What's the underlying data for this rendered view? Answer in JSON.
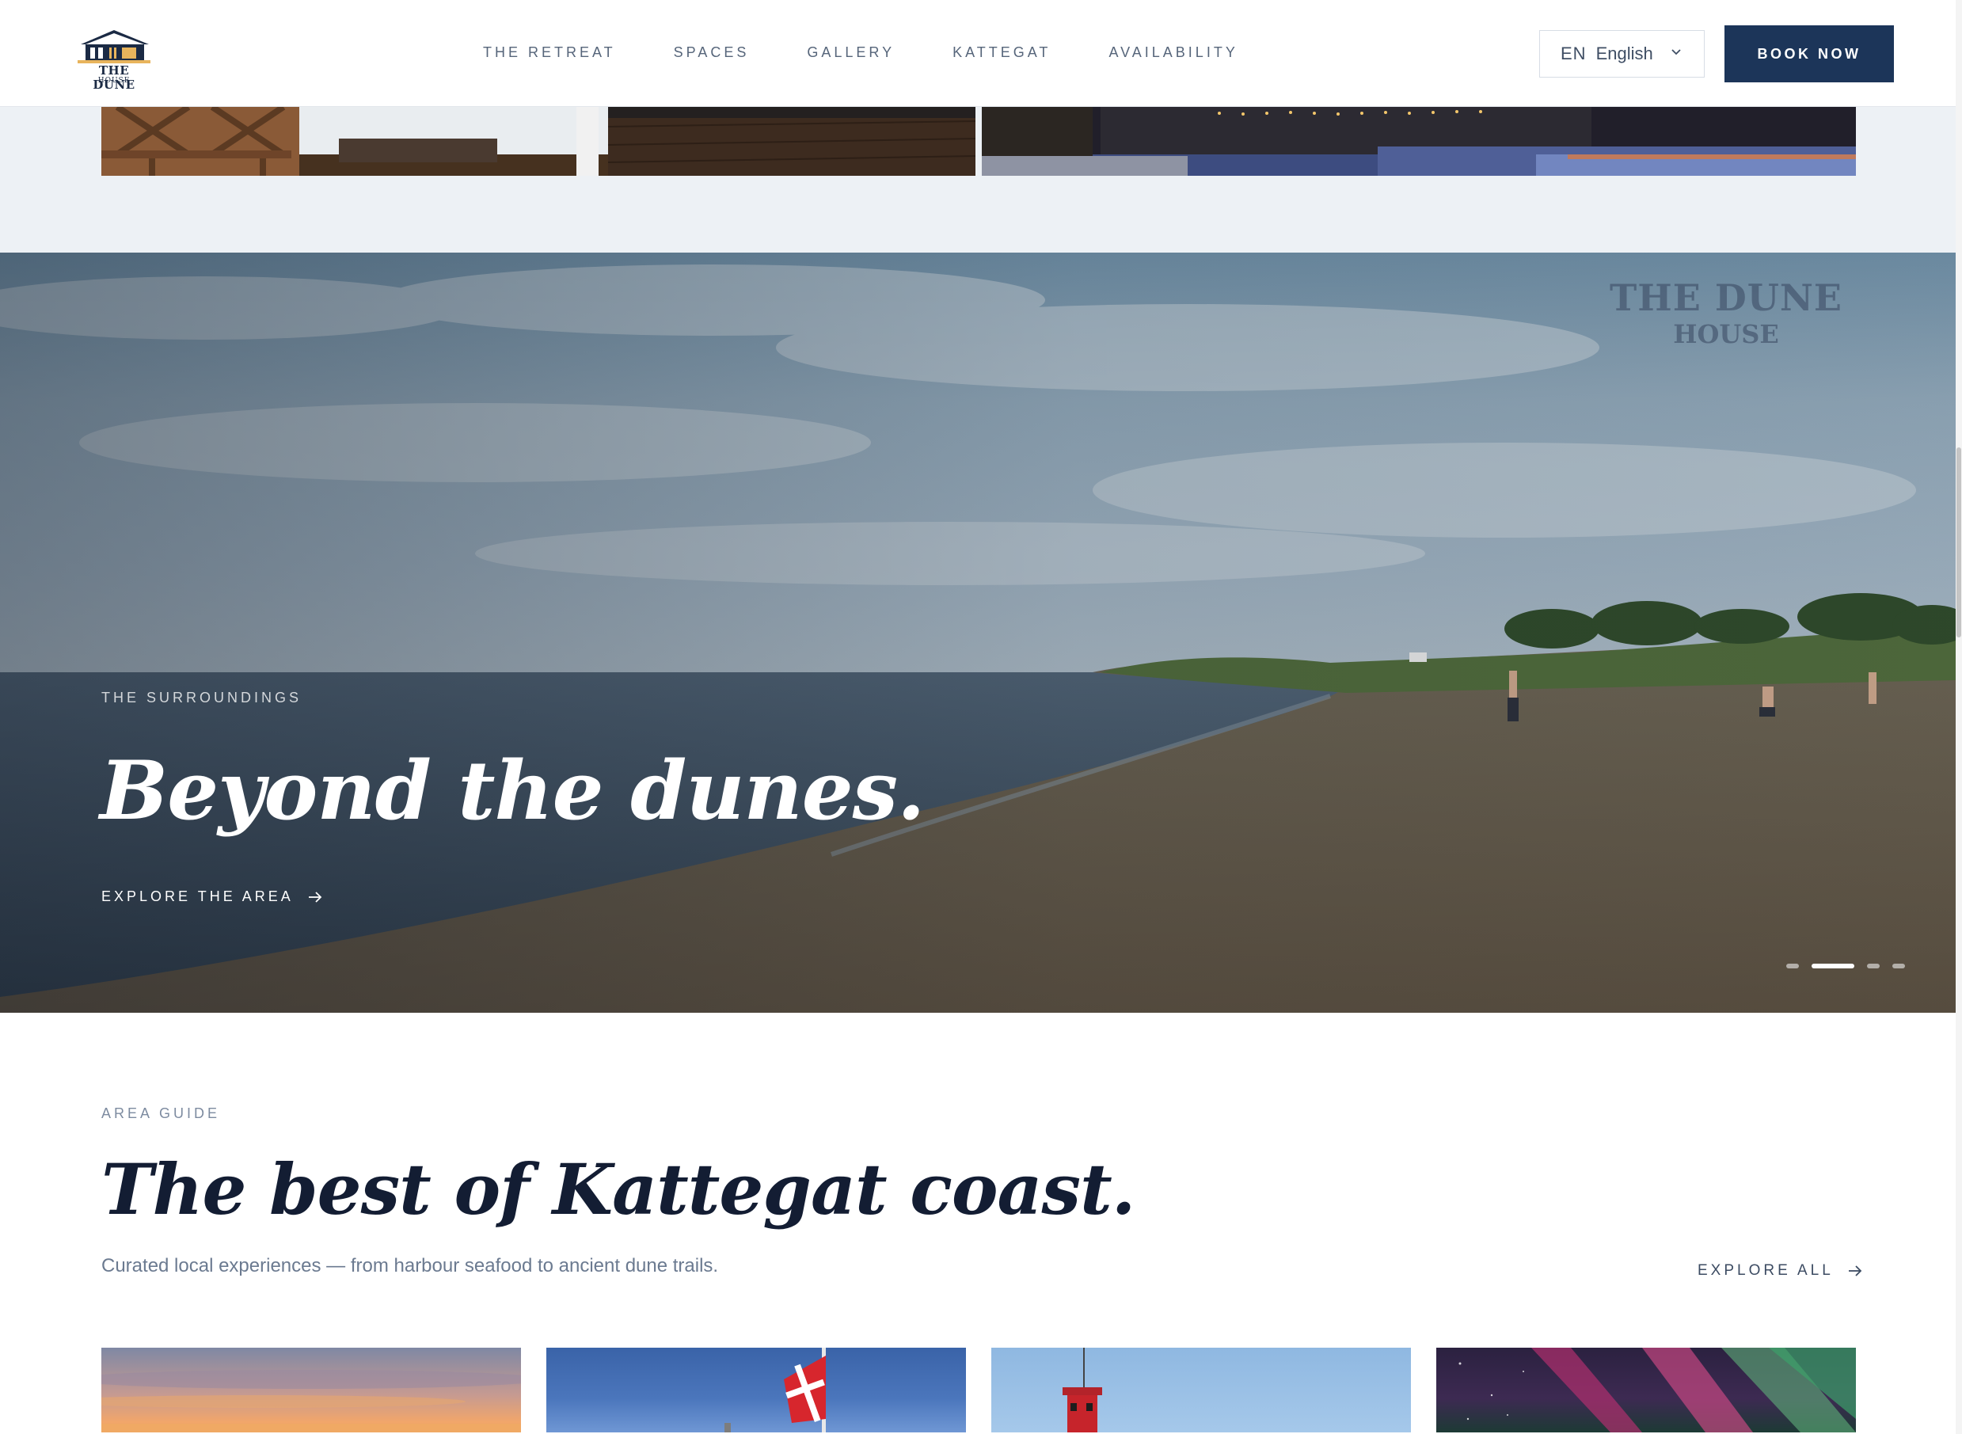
{
  "header": {
    "logo": {
      "line1": "THE DUNE",
      "line2": "HOUSE",
      "icon": "house-icon"
    },
    "nav": [
      {
        "label": "THE RETREAT"
      },
      {
        "label": "SPACES"
      },
      {
        "label": "GALLERY"
      },
      {
        "label": "KATTEGAT"
      },
      {
        "label": "AVAILABILITY"
      }
    ],
    "language": {
      "code": "EN",
      "label": "English",
      "icon": "chevron-down-icon"
    },
    "book_label": "BOOK NOW"
  },
  "hero": {
    "eyebrow": "THE SURROUNDINGS",
    "title": "Beyond the dunes.",
    "cta": "EXPLORE THE AREA",
    "cta_icon": "arrow-right-icon",
    "watermark": {
      "line1": "THE DUNE",
      "line2": "HOUSE"
    },
    "slides": {
      "count": 4,
      "active": 2
    }
  },
  "area_guide": {
    "eyebrow": "AREA GUIDE",
    "title": "The best of Kattegat coast.",
    "subtitle": "Curated local experiences — from harbour seafood to ancient dune trails.",
    "explore_all": "EXPLORE ALL",
    "explore_icon": "arrow-right-icon"
  },
  "colors": {
    "brand_navy": "#1c3559",
    "muted_text": "#6b7a90",
    "section_bg": "#edf1f5"
  }
}
